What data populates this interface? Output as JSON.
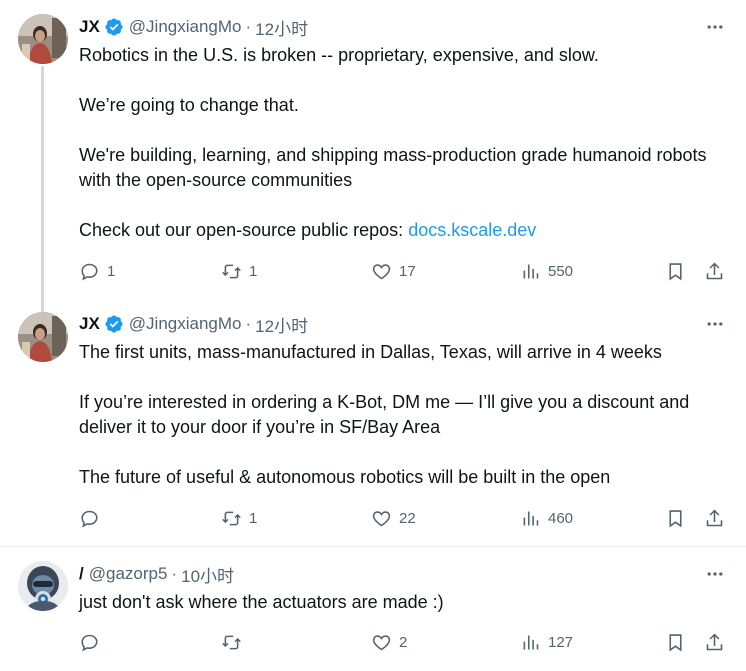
{
  "posts": [
    {
      "author": {
        "name": "JX",
        "handle": "@JingxiangMo",
        "verified": true
      },
      "time": "12小时",
      "paragraphs": [
        "Robotics in the U.S. is broken -- proprietary, expensive, and slow.",
        "We’re going to change that.",
        "We're building, learning, and shipping mass-production grade humanoid robots with the open-source communities"
      ],
      "last_paragraph_prefix": "Check out our open-source public repos: ",
      "link_text": "docs.kscale.dev",
      "stats": {
        "replies": "1",
        "reposts": "1",
        "likes": "17",
        "views": "550"
      }
    },
    {
      "author": {
        "name": "JX",
        "handle": "@JingxiangMo",
        "verified": true
      },
      "time": "12小时",
      "paragraphs": [
        "The first units, mass-manufactured in Dallas, Texas, will arrive in 4 weeks",
        "If you’re interested in ordering a K-Bot, DM me — I’ll give you a discount and deliver it to your door if you’re in SF/Bay Area",
        "The future of useful & autonomous robotics will be built in the open"
      ],
      "stats": {
        "replies": "",
        "reposts": "1",
        "likes": "22",
        "views": "460"
      }
    },
    {
      "author": {
        "name": "/",
        "handle": "@gazorp5",
        "verified": false
      },
      "time": "10小时",
      "paragraphs": [
        "just don't ask where the actuators are made :)"
      ],
      "stats": {
        "replies": "",
        "reposts": "",
        "likes": "2",
        "views": "127"
      }
    }
  ],
  "separator": "·",
  "icons": {
    "more": "more-horizontal-icon",
    "reply": "reply-icon",
    "repost": "repost-icon",
    "like": "heart-icon",
    "views": "views-icon",
    "bookmark": "bookmark-icon",
    "share": "share-icon",
    "verified": "verified-badge-icon"
  },
  "colors": {
    "link": "#1d9bf0",
    "secondary": "#536471",
    "verified": "#1d9bf0"
  }
}
